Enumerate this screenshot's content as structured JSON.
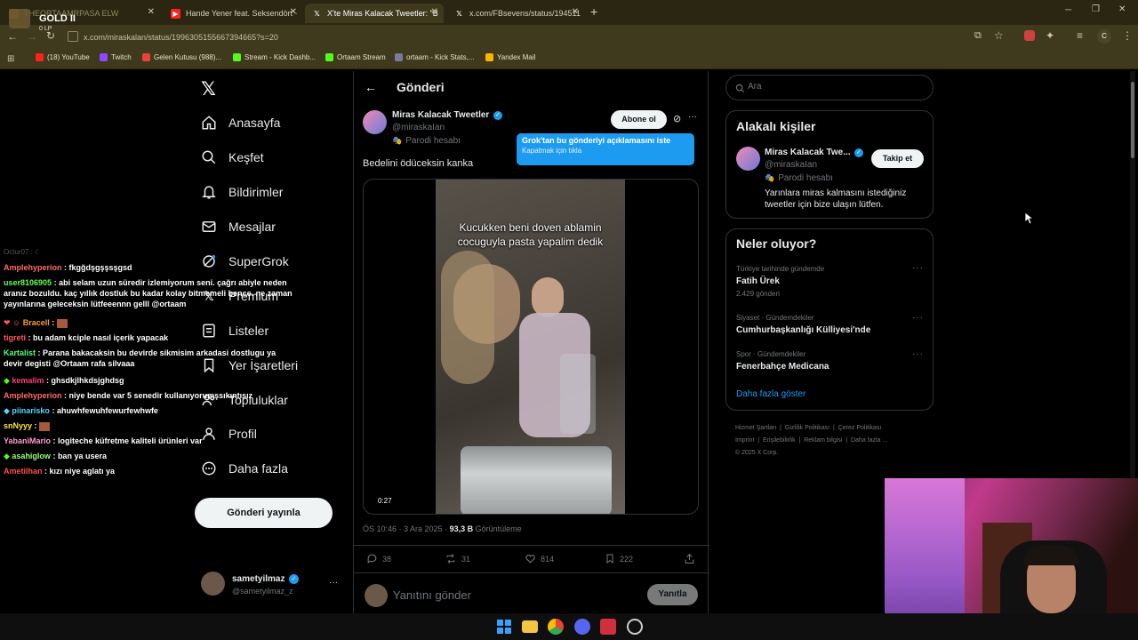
{
  "browser": {
    "tabs": [
      {
        "title": "THEORTAAMRPASA ELW",
        "active": false
      },
      {
        "title": "Hande Yener feat. Seksendört ·",
        "active": false
      },
      {
        "title": "X'te Miras Kalacak Tweetler: \"B",
        "active": true
      },
      {
        "title": "x.com/FBsevens/status/194511",
        "active": false
      }
    ],
    "url": "x.com/miraskalan/status/1996305155667394665?s=20",
    "bookmarks": [
      "(18) YouTube",
      "Twitch",
      "Gelen Kutusu (988)...",
      "Stream - Kick Dashb...",
      "Ortaam Stream",
      "ortaam - Kick Stats,...",
      "Yandex Mail"
    ],
    "profile_initial": "C"
  },
  "overlay": {
    "rank": "GOLD II",
    "lp": "0 LP"
  },
  "nav": {
    "items": [
      "Anasayfa",
      "Keşfet",
      "Bildirimler",
      "Mesajlar",
      "SuperGrok",
      "Premium",
      "Listeler",
      "Yer İşaretleri",
      "Topluluklar",
      "Profil",
      "Daha fazla"
    ],
    "post_button": "Gönderi yayınla",
    "account_name": "sametyilmaz",
    "account_handle": "@sametyilmaz_z"
  },
  "chat": [
    {
      "user": "Amplehyperion",
      "color": "#ff6b6b",
      "msg": "fkgğdşgşşsşgsd"
    },
    {
      "user": "user8106905",
      "color": "#63ff5a",
      "msg": "abi selam uzun süredir izlemiyorum seni. çağrı abiyle neden aranız bozuldu. kaç yıllık dostluk bu kadar kolay bitmemeli bence. ne zaman yayınlarına geleceksin lütfeeennn gelll @ortaam"
    },
    {
      "user": "Bracell",
      "color": "#ff9b3d",
      "msg": ""
    },
    {
      "user": "tigreti",
      "color": "#ff5a5a",
      "msg": "bu adam kciple nasıl içerik yapacak"
    },
    {
      "user": "Kartalist",
      "color": "#54ff7a",
      "msg": "Parana bakacaksin bu devirde sikmisim arkadasi dostlugu ya devir degisti @Ortaam rafa silvaaa"
    },
    {
      "user": "kemalim",
      "color": "#ff3d7a",
      "msg": "ghsdkjlhkdsjghdsg"
    },
    {
      "user": "Amplehyperion",
      "color": "#ff6b6b",
      "msg": "niye bende var 5 senedir kullanıyorumşsıkıntısız"
    },
    {
      "user": "piinarisko",
      "color": "#54d6ff",
      "msg": "ahuwhfewuhfewurfewhwfe"
    },
    {
      "user": "snNyyy",
      "color": "#ffe14d",
      "msg": ""
    },
    {
      "user": "YabaniMario",
      "color": "#ff9ad6",
      "msg": "logiteche küfretme kaliteli ürünleri var"
    },
    {
      "user": "asahiglow",
      "color": "#9bff6b",
      "msg": "ban ya usera"
    },
    {
      "user": "Ametilhan",
      "color": "#ff4d4d",
      "msg": "kızı niye aglatı ya"
    }
  ],
  "post": {
    "header": "Gönderi",
    "author_name": "Miras Kalacak Tweetler",
    "author_handle": "@miraskaIan",
    "parody_label": "Parodi hesabı",
    "follow_button": "Abone ol",
    "grok_tip_title": "Grok'tan bu gönderiyi açıklamasını iste",
    "grok_tip_sub": "Kapatmak için tıkla",
    "text": "Bedelini ödüceksin kanka",
    "video_caption": "Kucukken beni doven ablamin cocuguyla pasta yapalim dedik",
    "video_time": "0:27",
    "timestamp": "ÖS 10:46 · 3 Ara 2025 · ",
    "views_count": "93,3 B",
    "views_label": "Görüntüleme",
    "replies": "38",
    "reposts": "31",
    "likes": "814",
    "bookmarks": "222",
    "reply_placeholder": "Yanıtını gönder",
    "reply_button": "Yanıtla"
  },
  "sidebar": {
    "search_placeholder": "Ara",
    "relevant_title": "Alakalı kişiler",
    "relevant_name": "Miras Kalacak Twe...",
    "relevant_handle": "@miraskaIan",
    "relevant_parody": "Parodi hesabı",
    "relevant_bio": "Yarınlara miras kalmasını istediğiniz tweetler için bize ulaşın lütfen.",
    "follow_button": "Takip et",
    "trends_title": "Neler oluyor?",
    "trends": [
      {
        "context": "Türkiye tarihinde gündemde",
        "title": "Fatih Ürek",
        "count": "2.429 gönderi"
      },
      {
        "context": "Siyaset · Gündemdekiler",
        "title": "Cumhurbaşkanlığı Külliyesi'nde",
        "count": ""
      },
      {
        "context": "Spor · Gündemdekiler",
        "title": "Fenerbahçe Medicana",
        "count": ""
      }
    ],
    "show_more": "Daha fazla göster",
    "footer_links": [
      "Hizmet Şartları",
      "Gizlilik Politikası",
      "Çerez Politikası",
      "Imprint",
      "Erişilebilirlik",
      "Reklam bilgisi",
      "Daha fazla ..."
    ],
    "copyright": "© 2025 X Corp."
  },
  "colors": {
    "accent": "#1d9bf0",
    "chrome": "#3f3a1d",
    "tabbar": "#2a2612"
  }
}
